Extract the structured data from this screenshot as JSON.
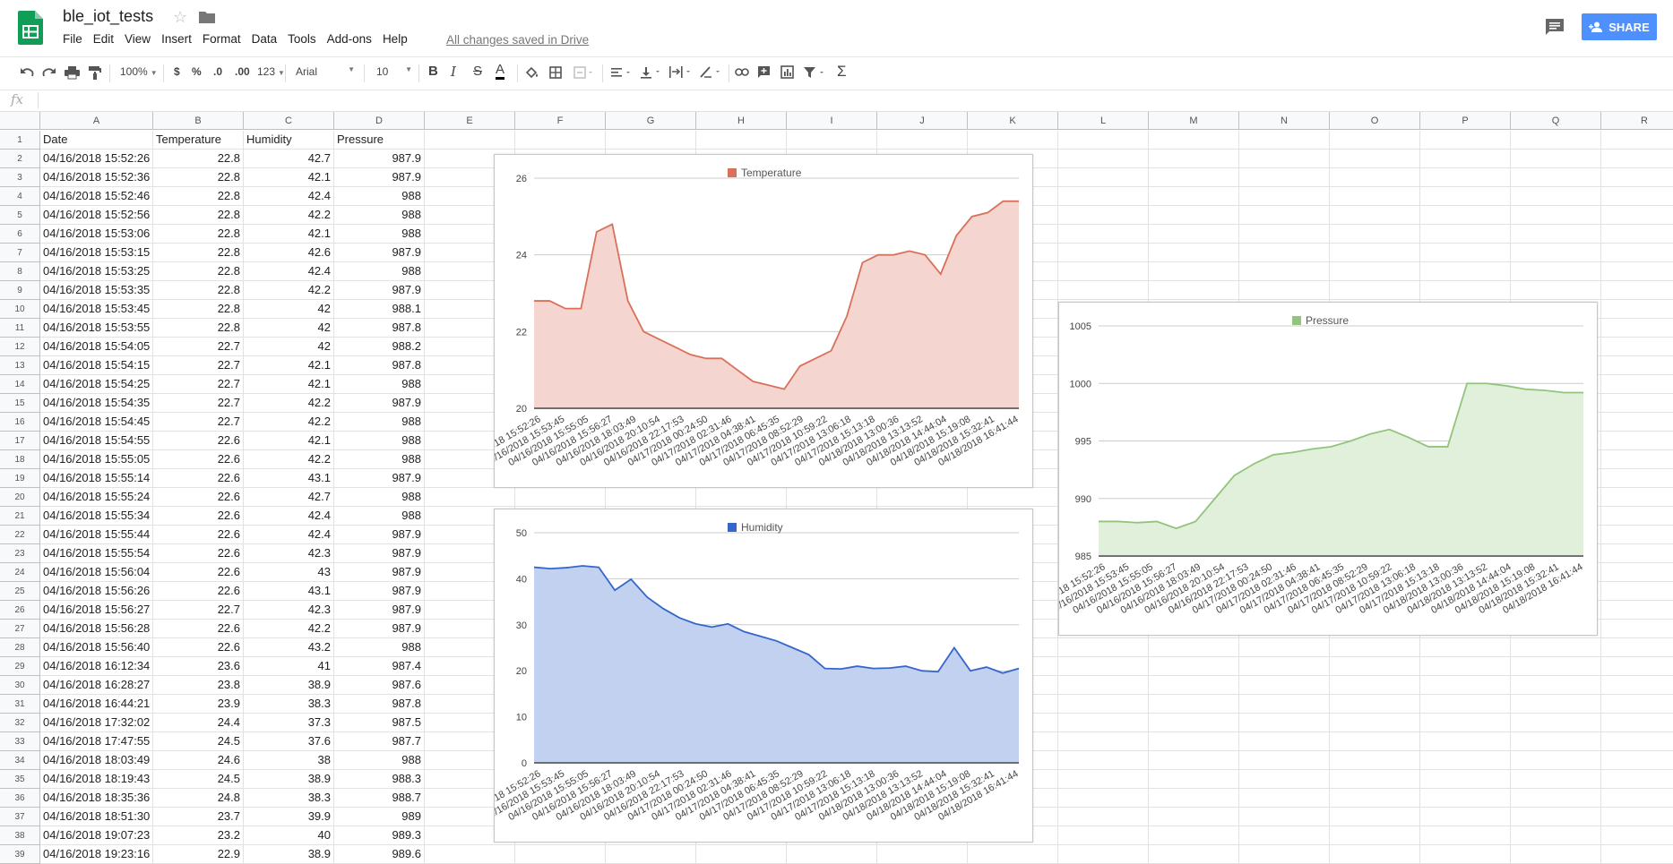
{
  "doc": {
    "title": "ble_iot_tests",
    "saved_status": "All changes saved in Drive"
  },
  "menu": [
    "File",
    "Edit",
    "View",
    "Insert",
    "Format",
    "Data",
    "Tools",
    "Add-ons",
    "Help"
  ],
  "share_label": "SHARE",
  "toolbar": {
    "zoom": "100%",
    "currency": "$",
    "percent": "%",
    "dec_less": ".0",
    "dec_more": ".00",
    "more_formats": "123",
    "font": "Arial",
    "font_size": "10",
    "bold": "B",
    "italic": "I",
    "strike": "S",
    "text_color": "A"
  },
  "formula_label": "fx",
  "columns": [
    "A",
    "B",
    "C",
    "D",
    "E",
    "F",
    "G",
    "H",
    "I",
    "J",
    "K",
    "L",
    "M",
    "N",
    "O",
    "P",
    "Q",
    "R"
  ],
  "header_row": [
    "Date",
    "Temperature",
    "Humidity",
    "Pressure"
  ],
  "rows": [
    [
      "04/16/2018 15:52:26",
      "22.8",
      "42.7",
      "987.9"
    ],
    [
      "04/16/2018 15:52:36",
      "22.8",
      "42.1",
      "987.9"
    ],
    [
      "04/16/2018 15:52:46",
      "22.8",
      "42.4",
      "988"
    ],
    [
      "04/16/2018 15:52:56",
      "22.8",
      "42.2",
      "988"
    ],
    [
      "04/16/2018 15:53:06",
      "22.8",
      "42.1",
      "988"
    ],
    [
      "04/16/2018 15:53:15",
      "22.8",
      "42.6",
      "987.9"
    ],
    [
      "04/16/2018 15:53:25",
      "22.8",
      "42.4",
      "988"
    ],
    [
      "04/16/2018 15:53:35",
      "22.8",
      "42.2",
      "987.9"
    ],
    [
      "04/16/2018 15:53:45",
      "22.8",
      "42",
      "988.1"
    ],
    [
      "04/16/2018 15:53:55",
      "22.8",
      "42",
      "987.8"
    ],
    [
      "04/16/2018 15:54:05",
      "22.7",
      "42",
      "988.2"
    ],
    [
      "04/16/2018 15:54:15",
      "22.7",
      "42.1",
      "987.8"
    ],
    [
      "04/16/2018 15:54:25",
      "22.7",
      "42.1",
      "988"
    ],
    [
      "04/16/2018 15:54:35",
      "22.7",
      "42.2",
      "987.9"
    ],
    [
      "04/16/2018 15:54:45",
      "22.7",
      "42.2",
      "988"
    ],
    [
      "04/16/2018 15:54:55",
      "22.6",
      "42.1",
      "988"
    ],
    [
      "04/16/2018 15:55:05",
      "22.6",
      "42.2",
      "988"
    ],
    [
      "04/16/2018 15:55:14",
      "22.6",
      "43.1",
      "987.9"
    ],
    [
      "04/16/2018 15:55:24",
      "22.6",
      "42.7",
      "988"
    ],
    [
      "04/16/2018 15:55:34",
      "22.6",
      "42.4",
      "988"
    ],
    [
      "04/16/2018 15:55:44",
      "22.6",
      "42.4",
      "987.9"
    ],
    [
      "04/16/2018 15:55:54",
      "22.6",
      "42.3",
      "987.9"
    ],
    [
      "04/16/2018 15:56:04",
      "22.6",
      "43",
      "987.9"
    ],
    [
      "04/16/2018 15:56:26",
      "22.6",
      "43.1",
      "987.9"
    ],
    [
      "04/16/2018 15:56:27",
      "22.7",
      "42.3",
      "987.9"
    ],
    [
      "04/16/2018 15:56:28",
      "22.6",
      "42.2",
      "987.9"
    ],
    [
      "04/16/2018 15:56:40",
      "22.6",
      "43.2",
      "988"
    ],
    [
      "04/16/2018 16:12:34",
      "23.6",
      "41",
      "987.4"
    ],
    [
      "04/16/2018 16:28:27",
      "23.8",
      "38.9",
      "987.6"
    ],
    [
      "04/16/2018 16:44:21",
      "23.9",
      "38.3",
      "987.8"
    ],
    [
      "04/16/2018 17:32:02",
      "24.4",
      "37.3",
      "987.5"
    ],
    [
      "04/16/2018 17:47:55",
      "24.5",
      "37.6",
      "987.7"
    ],
    [
      "04/16/2018 18:03:49",
      "24.6",
      "38",
      "988"
    ],
    [
      "04/16/2018 18:19:43",
      "24.5",
      "38.9",
      "988.3"
    ],
    [
      "04/16/2018 18:35:36",
      "24.8",
      "38.3",
      "988.7"
    ],
    [
      "04/16/2018 18:51:30",
      "23.7",
      "39.9",
      "989"
    ],
    [
      "04/16/2018 19:07:23",
      "23.2",
      "40",
      "989.3"
    ],
    [
      "04/16/2018 19:23:16",
      "22.9",
      "38.9",
      "989.6"
    ]
  ],
  "chart_data": [
    {
      "type": "area",
      "title": "",
      "legend": "top",
      "series": [
        {
          "name": "Temperature",
          "values": [
            22.8,
            22.8,
            22.6,
            22.6,
            24.6,
            24.8,
            22.8,
            22.0,
            21.8,
            21.6,
            21.4,
            21.3,
            21.3,
            21.0,
            20.7,
            20.6,
            20.5,
            21.1,
            21.3,
            21.5,
            22.4,
            23.8,
            24.0,
            24.0,
            24.1,
            24.0,
            23.5,
            24.5,
            25.0,
            25.1,
            25.4,
            25.4
          ]
        }
      ],
      "x": [
        "04/16/2018 15:52:26",
        "04/16/2018 15:53:45",
        "04/16/2018 15:55:05",
        "04/16/2018 15:56:27",
        "04/16/2018 18:03:49",
        "04/16/2018 20:10:54",
        "04/16/2018 22:17:53",
        "04/17/2018 00:24:50",
        "04/17/2018 02:31:46",
        "04/17/2018 04:38:41",
        "04/17/2018 06:45:35",
        "04/17/2018 08:52:29",
        "04/17/2018 10:59:22",
        "04/17/2018 13:06:18",
        "04/17/2018 15:13:18",
        "04/18/2018 13:00:36",
        "04/18/2018 13:13:52",
        "04/18/2018 14:44:04",
        "04/18/2018 15:19:08",
        "04/18/2018 15:32:41",
        "04/18/2018 16:41:44"
      ],
      "yticks": [
        20,
        22,
        24,
        26
      ],
      "ylim": [
        20,
        26
      ],
      "colors": {
        "line": "#d9705a",
        "fill": "#f4d5cf"
      }
    },
    {
      "type": "area",
      "title": "",
      "legend": "top",
      "series": [
        {
          "name": "Humidity",
          "values": [
            42.5,
            42.2,
            42.4,
            42.8,
            42.5,
            37.5,
            39.9,
            36.0,
            33.5,
            31.5,
            30.2,
            29.5,
            30.2,
            28.5,
            27.5,
            26.5,
            25.0,
            23.5,
            20.5,
            20.4,
            21.0,
            20.5,
            20.6,
            21.0,
            20.0,
            19.8,
            25.0,
            20.0,
            20.8,
            19.5,
            20.5
          ]
        }
      ],
      "x": [
        "04/16/2018 15:52:26",
        "04/16/2018 15:53:45",
        "04/16/2018 15:55:05",
        "04/16/2018 15:56:27",
        "04/16/2018 18:03:49",
        "04/16/2018 20:10:54",
        "04/16/2018 22:17:53",
        "04/17/2018 00:24:50",
        "04/17/2018 02:31:46",
        "04/17/2018 04:38:41",
        "04/17/2018 06:45:35",
        "04/17/2018 08:52:29",
        "04/17/2018 10:59:22",
        "04/17/2018 13:06:18",
        "04/17/2018 15:13:18",
        "04/18/2018 13:00:36",
        "04/18/2018 13:13:52",
        "04/18/2018 14:44:04",
        "04/18/2018 15:19:08",
        "04/18/2018 15:32:41",
        "04/18/2018 16:41:44"
      ],
      "yticks": [
        0,
        10,
        20,
        30,
        40,
        50
      ],
      "ylim": [
        0,
        50
      ],
      "colors": {
        "line": "#3466cc",
        "fill": "#c2d1ef"
      }
    },
    {
      "type": "area",
      "title": "",
      "legend": "top",
      "series": [
        {
          "name": "Pressure",
          "values": [
            988.0,
            988.0,
            987.9,
            988.0,
            987.4,
            988.0,
            990.0,
            992.0,
            993.0,
            993.8,
            994.0,
            994.3,
            994.5,
            995.0,
            995.6,
            996.0,
            995.3,
            994.5,
            994.5,
            1000.0,
            1000.0,
            999.8,
            999.5,
            999.4,
            999.2,
            999.2
          ]
        }
      ],
      "x": [
        "04/16/2018 15:52:26",
        "04/16/2018 15:53:45",
        "04/16/2018 15:55:05",
        "04/16/2018 15:56:27",
        "04/16/2018 18:03:49",
        "04/16/2018 20:10:54",
        "04/16/2018 22:17:53",
        "04/17/2018 00:24:50",
        "04/17/2018 02:31:46",
        "04/17/2018 04:38:41",
        "04/17/2018 06:45:35",
        "04/17/2018 08:52:29",
        "04/17/2018 10:59:22",
        "04/17/2018 13:06:18",
        "04/17/2018 15:13:18",
        "04/18/2018 13:00:36",
        "04/18/2018 13:13:52",
        "04/18/2018 14:44:04",
        "04/18/2018 15:19:08",
        "04/18/2018 15:32:41",
        "04/18/2018 16:41:44"
      ],
      "yticks": [
        985,
        990,
        995,
        1000,
        1005
      ],
      "ylim": [
        985,
        1005
      ],
      "colors": {
        "line": "#93c47d",
        "fill": "#e1f0da"
      }
    }
  ],
  "colors": {
    "sheets_green": "#0f9d58",
    "share_blue": "#4d90fe"
  }
}
